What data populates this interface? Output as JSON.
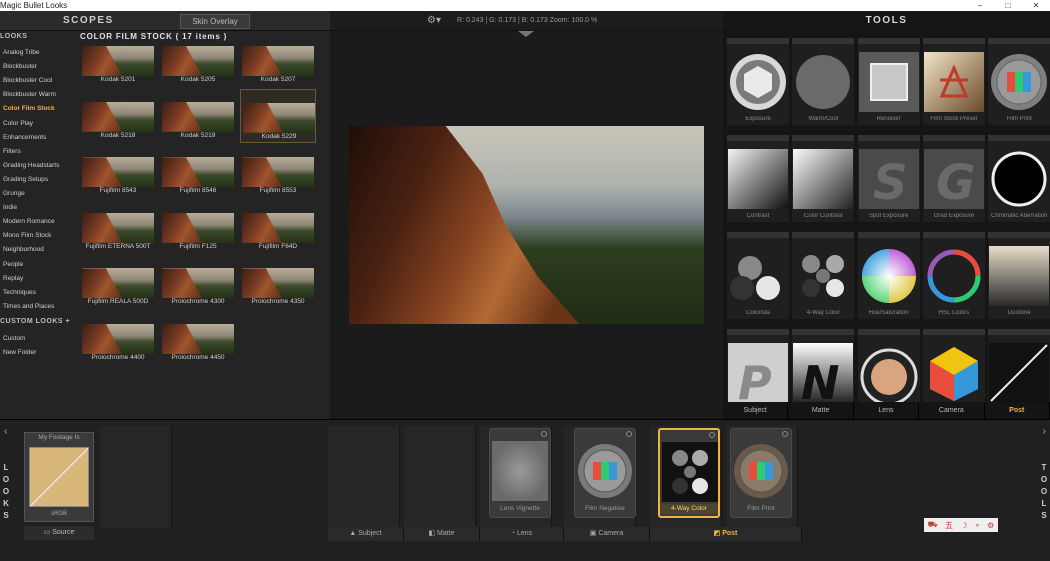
{
  "window": {
    "title": "Magic Bullet Looks",
    "minimize": "–",
    "maximize": "□",
    "close": "✕"
  },
  "header": {
    "scopes_label": "SCOPES",
    "skin_overlay_label": "Skin Overlay",
    "gear": "⚙▾",
    "readout": "R: 0.243 | G: 0.173 | B: 0.173   Zoom: 100.0 %",
    "tools_label": "TOOLS"
  },
  "looks": {
    "heading": "LOOKS",
    "categories": [
      "Analog Tribe",
      "Blockbuster",
      "Blockbuster Cool",
      "Blockbuster Warm",
      "Color Film Stock",
      "Color Play",
      "Enhancements",
      "Filters",
      "Grading Headstarts",
      "Grading Setups",
      "Grunge",
      "Indie",
      "Modern Romance",
      "Mono Film Stock",
      "Neighborhood",
      "People",
      "Replay",
      "Techniques",
      "Times and Places"
    ],
    "active_category": "Color Film Stock",
    "custom_heading": "CUSTOM LOOKS +",
    "custom_items": [
      "Custom",
      "New Folder"
    ]
  },
  "grid": {
    "title": "COLOR FILM STOCK ( 17 items )",
    "items": [
      "Kodak 5201",
      "Kodak 5205",
      "Kodak 5207",
      "Kodak 5218",
      "Kodak 5219",
      "Kodak 5229",
      "Fujifilm 8543",
      "Fujifilm 8546",
      "Fujifilm 8553",
      "Fujifilm ETERNA 500T",
      "Fujifilm F125",
      "Fujifilm F64D",
      "Fujifilm REALA 500D",
      "Prolochrome 4300",
      "Prolochrome 4350",
      "Prolochrome 4400",
      "Prolochrome 4450"
    ],
    "selected": "Kodak 5229"
  },
  "tools": {
    "items": [
      "Exposure",
      "Warm/Cool",
      "Renoiser",
      "Film Stock Preset",
      "Film Print",
      "Contrast",
      "Color Contrast",
      "Spot Exposure",
      "Grad Exposure",
      "Chromatic Aberration",
      "Colorista",
      "4-Way Color",
      "Hue/Saturation",
      "HSL Colors",
      "Duotone",
      "",
      "",
      "",
      "",
      ""
    ],
    "tabs": [
      "Subject",
      "Matte",
      "Lens",
      "Camera",
      "Post"
    ],
    "active_tab": "Post"
  },
  "pipeline": {
    "left_label": [
      "L",
      "O",
      "O",
      "K",
      "S"
    ],
    "right_label": [
      "T",
      "O",
      "O",
      "L",
      "S"
    ],
    "prev_arrow": "‹",
    "next_arrow": "›",
    "source_caption": "My Footage Is",
    "source_colorspace": "sRGB",
    "source_button": "Source",
    "cards": [
      "Lens Vignette",
      "Film Negative",
      "4-Way Color",
      "Film Print"
    ],
    "active_card": "4-Way Color",
    "tabs": [
      "Subject",
      "Matte",
      "Lens",
      "Camera",
      "Post"
    ],
    "active_tab": "Post",
    "mini_tools": [
      "⛟",
      "五",
      "☽",
      "∘",
      "⚙"
    ]
  }
}
